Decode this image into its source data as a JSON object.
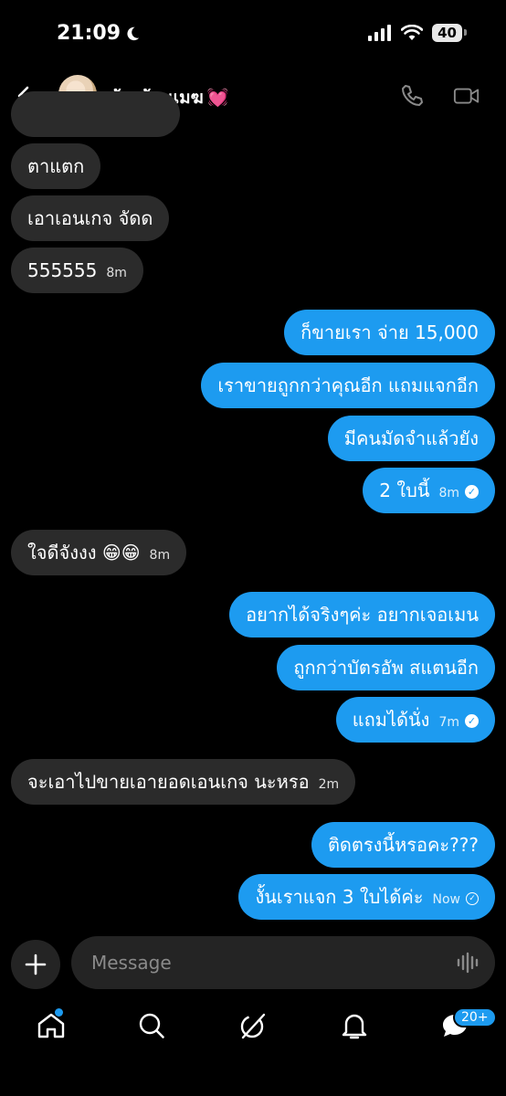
{
  "status_bar": {
    "time": "21:09",
    "battery": "40"
  },
  "header": {
    "contact_name": "น้องก้อนเมฆ",
    "contact_emoji": "💓"
  },
  "messages": [
    {
      "text": "ตาแตก",
      "meta": ""
    },
    {
      "text": "เอาเอนเกจ จัดด",
      "meta": ""
    },
    {
      "text": "555555",
      "meta": "8m"
    },
    {
      "text": "ก็ขายเรา จ่าย 15,000",
      "meta": ""
    },
    {
      "text": "เราขายถูกกว่าคุณอีก แถมแจกอีก",
      "meta": ""
    },
    {
      "text": "มีคนมัดจำแล้วยัง",
      "meta": ""
    },
    {
      "text": "2 ใบนี้",
      "meta": "8m"
    },
    {
      "text": "ใจดีจังงง 😁😁",
      "meta": "8m"
    },
    {
      "text": "อยากได้จริงๆค่ะ อยากเจอเมน",
      "meta": ""
    },
    {
      "text": "ถูกกว่าบัตรอัพ สแตนอีก",
      "meta": ""
    },
    {
      "text": "แถมได้นั่ง",
      "meta": "7m"
    },
    {
      "text": "จะเอาไปขายเอายอดเอนเกจ นะหรอ",
      "meta": "2m"
    },
    {
      "text": "ติดตรงนี้หรอคะ???",
      "meta": ""
    },
    {
      "text": "งั้นเราแจก 3 ใบได้ค่ะ",
      "meta": "Now"
    }
  ],
  "composer": {
    "placeholder": "Message"
  },
  "tabbar": {
    "badge": "20+"
  },
  "colors": {
    "accent": "#1d9bf0",
    "incoming_bubble": "#2b2b2b"
  }
}
